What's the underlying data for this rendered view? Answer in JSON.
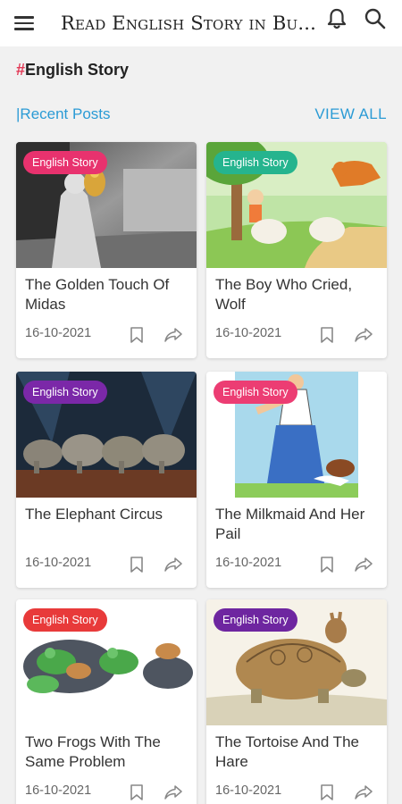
{
  "app": {
    "title": "Read English Story in Bu..."
  },
  "tag_heading": {
    "hash": "#",
    "name": "English Story"
  },
  "section": {
    "title": "|Recent Posts",
    "view_all": "VIEW ALL"
  },
  "posts": [
    {
      "badge": "English Story",
      "badge_color": "#e8326e",
      "title": "The Golden Touch Of Midas",
      "date": "16-10-2021"
    },
    {
      "badge": "English Story",
      "badge_color": "#25b48e",
      "title": "The Boy Who Cried, Wolf",
      "date": "16-10-2021"
    },
    {
      "badge": "English Story",
      "badge_color": "#7b28a8",
      "title": "The Elephant Circus",
      "date": "16-10-2021"
    },
    {
      "badge": "English Story",
      "badge_color": "#ec3d73",
      "title": "The Milkmaid And Her Pail",
      "date": "16-10-2021"
    },
    {
      "badge": "English Story",
      "badge_color": "#e83a3a",
      "title": "Two Frogs With The Same Problem",
      "date": "16-10-2021"
    },
    {
      "badge": "English Story",
      "badge_color": "#6e26a0",
      "title": "The Tortoise And The Hare",
      "date": "16-10-2021"
    }
  ],
  "icons": {
    "menu": "menu-icon",
    "bell": "bell-icon",
    "search": "search-icon",
    "bookmark": "bookmark-icon",
    "share": "share-icon"
  }
}
